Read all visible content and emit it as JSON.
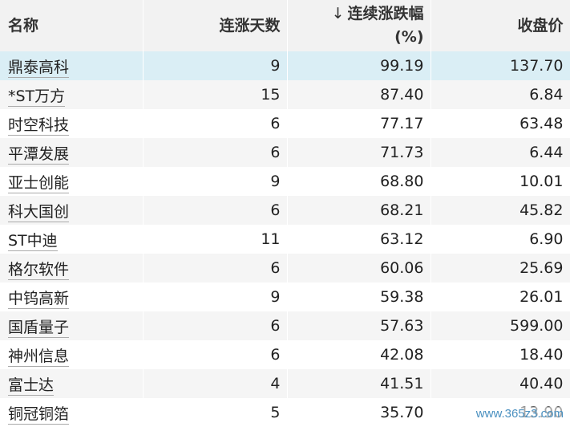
{
  "table": {
    "headers": {
      "name": "名称",
      "streak_days": "连涨天数",
      "change_pct_arrow": "↓",
      "change_pct": "连续涨跌幅",
      "change_pct_unit": "(%)",
      "close_price": "收盘价"
    },
    "rows": [
      {
        "name": "鼎泰高科",
        "streak_days": "9",
        "change_pct": "99.19",
        "close_price": "137.70"
      },
      {
        "name": "*ST万方",
        "streak_days": "15",
        "change_pct": "87.40",
        "close_price": "6.84"
      },
      {
        "name": "时空科技",
        "streak_days": "6",
        "change_pct": "77.17",
        "close_price": "63.48"
      },
      {
        "name": "平潭发展",
        "streak_days": "6",
        "change_pct": "71.73",
        "close_price": "6.44"
      },
      {
        "name": "亚士创能",
        "streak_days": "9",
        "change_pct": "68.80",
        "close_price": "10.01"
      },
      {
        "name": "科大国创",
        "streak_days": "6",
        "change_pct": "68.21",
        "close_price": "45.82"
      },
      {
        "name": "ST中迪",
        "streak_days": "11",
        "change_pct": "63.12",
        "close_price": "6.90"
      },
      {
        "name": "格尔软件",
        "streak_days": "6",
        "change_pct": "60.06",
        "close_price": "25.69"
      },
      {
        "name": "中钨高新",
        "streak_days": "9",
        "change_pct": "59.38",
        "close_price": "26.01"
      },
      {
        "name": "国盾量子",
        "streak_days": "6",
        "change_pct": "57.63",
        "close_price": "599.00"
      },
      {
        "name": "神州信息",
        "streak_days": "6",
        "change_pct": "42.08",
        "close_price": "18.40"
      },
      {
        "name": "富士达",
        "streak_days": "4",
        "change_pct": "41.51",
        "close_price": "40.40"
      },
      {
        "name": "铜冠铜箔",
        "streak_days": "5",
        "change_pct": "35.70",
        "close_price": "13.90"
      }
    ]
  },
  "watermark": "www.365z3.com",
  "colors": {
    "header_bg": "#f2f2f2",
    "highlight_row_bg": "#daeef5",
    "stripe_bg": "#f5f5f5"
  }
}
